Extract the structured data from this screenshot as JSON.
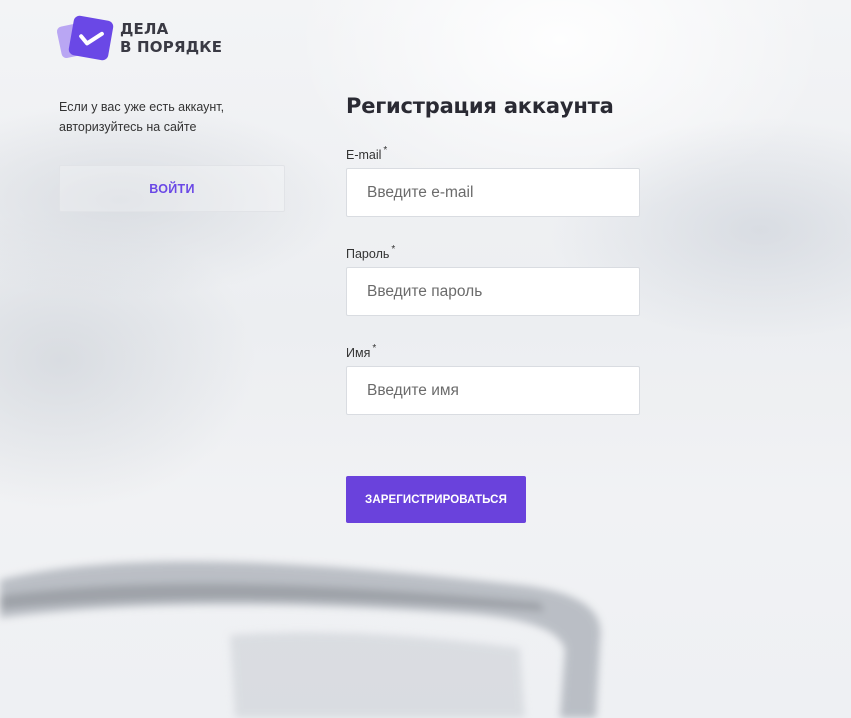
{
  "brand": {
    "line1": "ДЕЛА",
    "line2": "В ПОРЯДКЕ",
    "icon": "check-icon",
    "accent_color": "#6a48e6"
  },
  "aside": {
    "text_line1": "Если у вас уже есть аккаунт,",
    "text_line2": "авторизуйтесь на сайте",
    "login_label": "ВОЙТИ"
  },
  "form": {
    "title": "Регистрация аккаунта",
    "fields": [
      {
        "label": "E-mail",
        "required_mark": "*",
        "placeholder": "Введите e-mail",
        "value": ""
      },
      {
        "label": "Пароль",
        "required_mark": "*",
        "placeholder": "Введите пароль",
        "value": ""
      },
      {
        "label": "Имя",
        "required_mark": "*",
        "placeholder": "Введите имя",
        "value": ""
      }
    ],
    "submit_label": "ЗАРЕГИСТРИРОВАТЬСЯ",
    "submit_color": "#6a42dc"
  }
}
